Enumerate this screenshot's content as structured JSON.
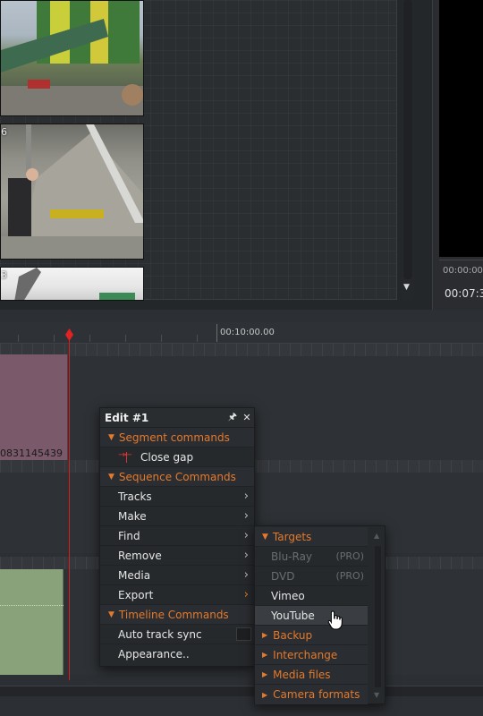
{
  "bin": {
    "thumbs": [
      {
        "number": ""
      },
      {
        "number": "6"
      },
      {
        "number": "3"
      }
    ]
  },
  "viewer": {
    "timecode_top": "00:00:00",
    "timecode_main": "00:07:3"
  },
  "timeline": {
    "ruler_timecode": "00:10:00.00",
    "clip_name": "0831145439"
  },
  "edit_menu": {
    "title": "Edit #1",
    "pin_icon": "pin-icon",
    "close_icon": "close-icon",
    "sections": {
      "segment": "Segment commands",
      "sequence": "Sequence Commands",
      "timeline": "Timeline Commands"
    },
    "items": {
      "close_gap": "Close gap",
      "tracks": "Tracks",
      "make": "Make",
      "find": "Find",
      "remove": "Remove",
      "media": "Media",
      "export": "Export",
      "auto_track_sync": "Auto track sync",
      "appearance": "Appearance.."
    }
  },
  "export_submenu": {
    "targets": "Targets",
    "bluray": "Blu-Ray",
    "bluray_tag": "(PRO)",
    "dvd": "DVD",
    "dvd_tag": "(PRO)",
    "vimeo": "Vimeo",
    "youtube": "YouTube",
    "backup": "Backup",
    "interchange": "Interchange",
    "media_files": "Media files",
    "camera_formats": "Camera formats"
  },
  "colors": {
    "accent": "#e57a2c",
    "playhead": "#d61e1e",
    "clip_pink": "#7a5a6a",
    "clip_green": "#8aa27a"
  }
}
